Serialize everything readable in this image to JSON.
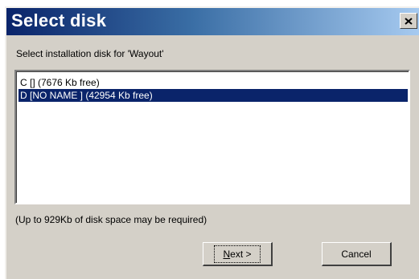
{
  "window": {
    "title": "Select disk",
    "close_label": "Close"
  },
  "dialog": {
    "prompt": "Select installation disk for 'Wayout'",
    "disks": [
      {
        "label": "C [] (7676 Kb free)",
        "selected": false
      },
      {
        "label": "D [NO NAME    ] (42954 Kb free)",
        "selected": true
      }
    ],
    "note": "(Up to 929Kb of disk space may be required)"
  },
  "buttons": {
    "next_mnemonic": "N",
    "next_rest": "ext >",
    "cancel_label": "Cancel"
  },
  "colors": {
    "title_start": "#0a246a",
    "title_end": "#a6caf0",
    "selection": "#0a246a",
    "face": "#d4d0c8"
  }
}
